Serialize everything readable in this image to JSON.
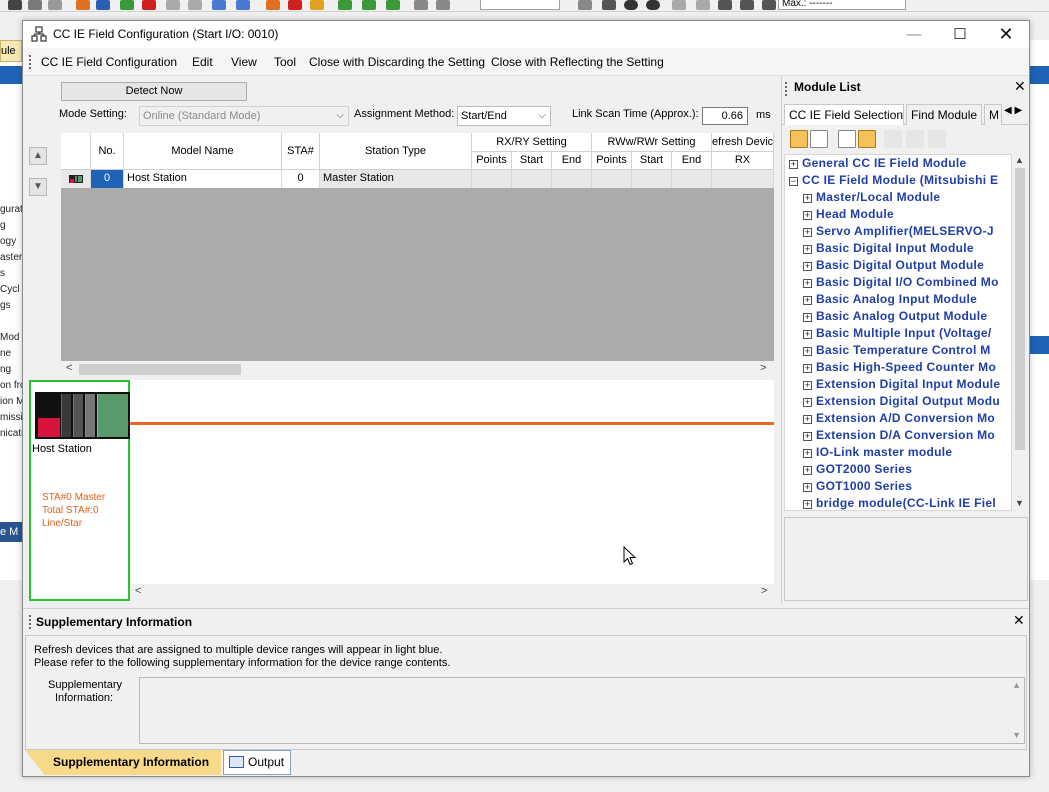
{
  "window": {
    "title": "CC IE Field Configuration (Start I/O: 0010)",
    "controls": {
      "minimize": "—",
      "maximize": "☐",
      "close": "✕"
    }
  },
  "menu": [
    "CC IE Field Configuration",
    "Edit",
    "View",
    "Tool",
    "Close with Discarding the Setting",
    "Close with Reflecting the Setting"
  ],
  "config": {
    "detect_now": "Detect Now",
    "mode_setting_label": "Mode Setting:",
    "mode_setting_value": "Online (Standard Mode)",
    "assignment_label": "Assignment Method:",
    "assignment_value": "Start/End",
    "link_scan_label": "Link Scan Time (Approx.):",
    "link_scan_value": "0.66",
    "link_scan_unit": "ms",
    "table": {
      "headers": {
        "no": "No.",
        "model": "Model Name",
        "sta": "STA#",
        "station_type": "Station Type",
        "rxry": "RX/RY Setting",
        "rww": "RWw/RWr Setting",
        "refresh": "efresh Devic",
        "points": "Points",
        "start": "Start",
        "end": "End",
        "rx": "RX"
      },
      "rows": [
        {
          "no": "0",
          "model": "Host Station",
          "sta": "0",
          "station_type": "Master Station"
        }
      ]
    },
    "canvas": {
      "host_label": "Host Station",
      "sta_line1": "STA#0  Master",
      "sta_line2": "Total STA#:0",
      "sta_line3": "Line/Star"
    }
  },
  "module_list": {
    "title": "Module List",
    "tabs": [
      "CC IE Field Selection",
      "Find Module",
      "M"
    ],
    "items": [
      {
        "sign": "⊞",
        "label": "General CC IE Field Module",
        "level": 0
      },
      {
        "sign": "⊟",
        "label": "CC IE Field Module (Mitsubishi E",
        "level": 0
      },
      {
        "sign": "⊞",
        "label": "Master/Local Module",
        "level": 1
      },
      {
        "sign": "⊞",
        "label": "Head Module",
        "level": 1
      },
      {
        "sign": "⊞",
        "label": "Servo Amplifier(MELSERVO-J",
        "level": 1
      },
      {
        "sign": "⊞",
        "label": "Basic Digital Input Module",
        "level": 1
      },
      {
        "sign": "⊞",
        "label": "Basic Digital Output Module",
        "level": 1
      },
      {
        "sign": "⊞",
        "label": "Basic Digital I/O Combined Mo",
        "level": 1
      },
      {
        "sign": "⊞",
        "label": "Basic Analog Input Module",
        "level": 1
      },
      {
        "sign": "⊞",
        "label": "Basic Analog Output Module",
        "level": 1
      },
      {
        "sign": "⊞",
        "label": "Basic Multiple Input (Voltage/",
        "level": 1
      },
      {
        "sign": "⊞",
        "label": "Basic Temperature Control M",
        "level": 1
      },
      {
        "sign": "⊞",
        "label": "Basic High-Speed Counter Mo",
        "level": 1
      },
      {
        "sign": "⊞",
        "label": "Extension Digital Input Module",
        "level": 1
      },
      {
        "sign": "⊞",
        "label": "Extension Digital Output Modu",
        "level": 1
      },
      {
        "sign": "⊞",
        "label": "Extension A/D Conversion Mo",
        "level": 1
      },
      {
        "sign": "⊞",
        "label": "Extension D/A Conversion Mo",
        "level": 1
      },
      {
        "sign": "⊞",
        "label": "IO-Link master module",
        "level": 1
      },
      {
        "sign": "⊞",
        "label": "GOT2000 Series",
        "level": 1
      },
      {
        "sign": "⊞",
        "label": "GOT1000 Series",
        "level": 1
      },
      {
        "sign": "⊞",
        "label": "bridge module(CC-Link IE Fiel",
        "level": 1
      }
    ]
  },
  "supplementary": {
    "title": "Supplementary Information",
    "line1": "Refresh devices that are assigned to multiple device ranges will appear in light blue.",
    "line2": "Please refer to the following supplementary information for the device range contents.",
    "field_label": "Supplementary Information:",
    "tab_active": "Supplementary Information",
    "tab_output": "Output"
  },
  "background": {
    "search_box": "Max.: -------",
    "left_tab": "ule",
    "left_snippets": [
      "gurati",
      "g",
      "ogy",
      "aster",
      "s",
      "Cycl",
      "gs",
      "Mod",
      "ne",
      "ng",
      "on fro",
      "ion M",
      "missi",
      "nicati"
    ],
    "bottom_bar": "e M"
  },
  "colors": {
    "network_line": "#e8691e",
    "host_border": "#2dc12d",
    "tree_text": "#1f3fa6",
    "sta_info": "#e0601a",
    "selected_no": "#1e63b5"
  }
}
